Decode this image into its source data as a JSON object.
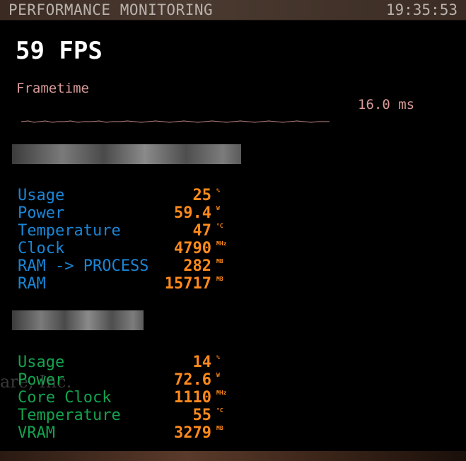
{
  "header": {
    "title": "PERFORMANCE MONITORING",
    "clock": "19:35:53"
  },
  "fps": {
    "text": "59 FPS"
  },
  "frametime": {
    "label": "Frametime",
    "value": "16.0 ms"
  },
  "cpu_stats": [
    {
      "label": "Usage",
      "value": "25",
      "unit": "%"
    },
    {
      "label": "Power",
      "value": "59.4",
      "unit": "W"
    },
    {
      "label": "Temperature",
      "value": "47",
      "unit": "°C"
    },
    {
      "label": "Clock",
      "value": "4790",
      "unit": "MHz"
    },
    {
      "label": "RAM -> PROCESS",
      "value": "282",
      "unit": "MB"
    },
    {
      "label": "RAM",
      "value": "15717",
      "unit": "MB"
    }
  ],
  "gpu_stats": [
    {
      "label": "Usage",
      "value": "14",
      "unit": "%"
    },
    {
      "label": "Power",
      "value": "72.6",
      "unit": "W"
    },
    {
      "label": "Core Clock",
      "value": "1110",
      "unit": "MHz"
    },
    {
      "label": "Temperature",
      "value": "55",
      "unit": "°C"
    },
    {
      "label": "VRAM",
      "value": "3279",
      "unit": "MB"
    }
  ],
  "watermark": {
    "text": "are, Inc."
  },
  "colors": {
    "cpu_label": "#1a86d6",
    "gpu_label": "#13a34e",
    "value": "#ff8a1c",
    "frametime": "#d99a97"
  }
}
